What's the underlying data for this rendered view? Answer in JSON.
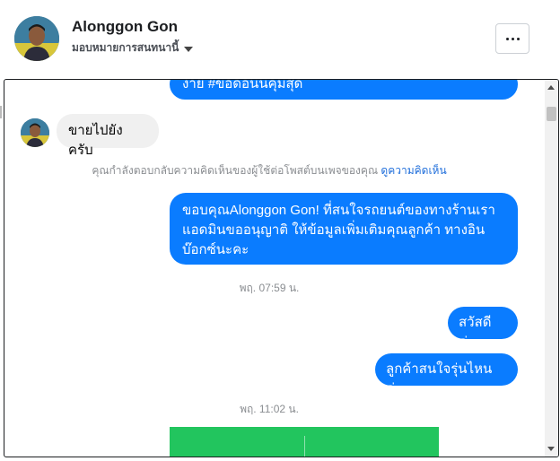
{
  "header": {
    "name": "Alonggon Gon",
    "subtitle": "มอบหมายการสนทนานี้"
  },
  "messages": {
    "top_partial": "ง่าย #ข้อดอนนิคุมสุด",
    "incoming_1": "ขายไปยังครับ",
    "notice_text": "คุณกำลังตอบกลับความคิดเห็นของผู้ใช้ต่อโพสต์บนเพจของคุณ",
    "notice_link": "ดูความคิดเห็น",
    "outgoing_1_line1": "ขอบคุณAlonggon Gon! ที่สนใจรถยนต์ของทางร้านเรา",
    "outgoing_1_line2": "แอดมินขออนุญาติ ให้ข้อมูลเพิ่มเติมคุณลูกค้า ทางอิน",
    "outgoing_1_line3": "บ๊อกซ์นะคะ",
    "time_1": "พฤ. 07:59 น.",
    "outgoing_2": "สวัสดีค่ะ",
    "outgoing_3": "ลูกค้าสนใจรุ่นไหนค่ะ",
    "time_2": "พฤ. 11:02 น."
  },
  "icons": {
    "more": "more-options-icon",
    "caret": "caret-down-icon"
  },
  "colors": {
    "outgoing_bubble": "#0a7cff",
    "incoming_bubble": "#f0f0f0",
    "link": "#216fdb",
    "card": "#22c55e"
  }
}
